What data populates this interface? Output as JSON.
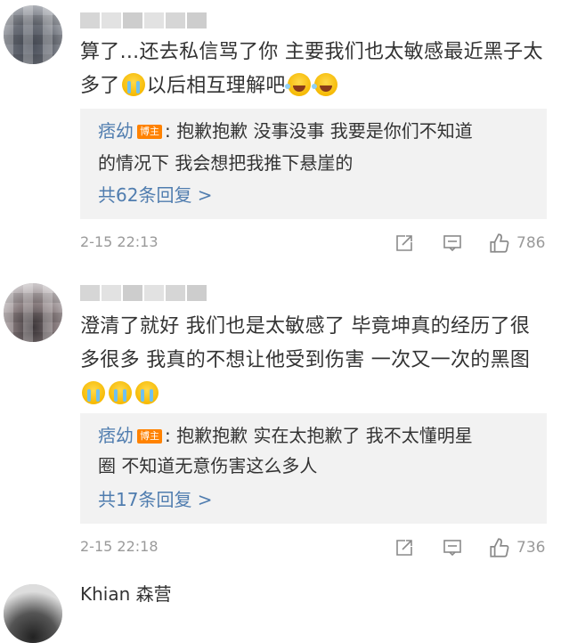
{
  "comments": [
    {
      "text_a": "算了...还去私信骂了你 主要我们也太敏感最近黑子太多了",
      "text_b": "以后相互理解吧",
      "reply": {
        "author": "痞幼",
        "badge": "博主",
        "line1": ": 抱歉抱歉 没事没事 我要是你们不知道",
        "line2": "的情况下 我会想把我推下悬崖的",
        "count_label": "共62条回复 >"
      },
      "timestamp": "2-15 22:13",
      "likes": "786"
    },
    {
      "text_a": "澄清了就好 我们也是太敏感了 毕竟坤真的经历了很多很多 我真的不想让他受到伤害 一次又一次的黑图",
      "reply": {
        "author": "痞幼",
        "badge": "博主",
        "line1": ": 抱歉抱歉 实在太抱歉了 我不太懂明星",
        "line2": "圈 不知道无意伤害这么多人",
        "count_label": "共17条回复 >"
      },
      "timestamp": "2-15 22:18",
      "likes": "736"
    }
  ],
  "third": {
    "name_partial": "Khian 森营"
  },
  "icons": [
    "share-icon",
    "comment-icon",
    "like-icon",
    "cry-emoji",
    "laugh-emoji"
  ],
  "colors": {
    "link": "#507daf",
    "badge": "#ff8200",
    "reply_bg": "#f2f2f2",
    "meta": "#9a9a9a"
  }
}
